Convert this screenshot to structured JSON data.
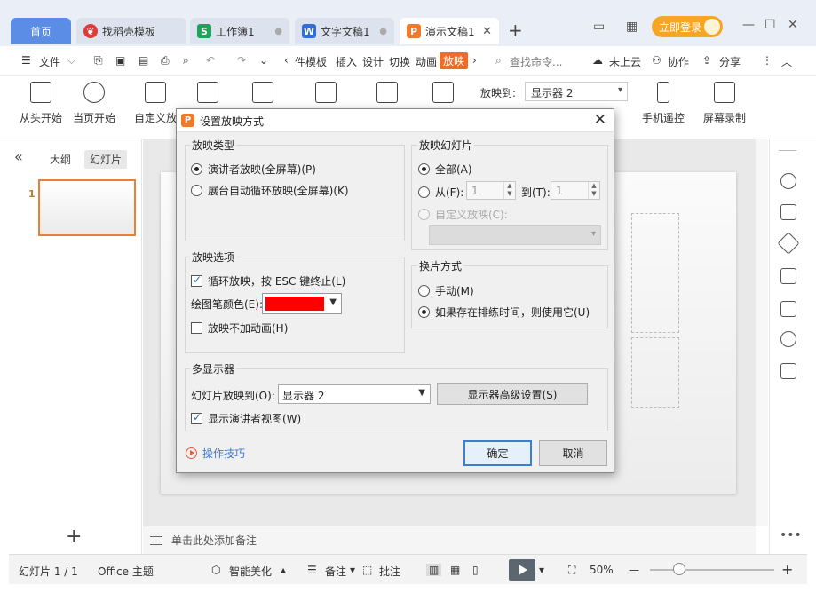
{
  "tabs": [
    {
      "label": "首页",
      "icon": "home-tab"
    },
    {
      "label": "找稻壳模板",
      "icon": "docer-icon"
    },
    {
      "label": "工作簿1",
      "icon": "spreadsheet-icon",
      "icon_glyph": "S"
    },
    {
      "label": "文字文稿1",
      "icon": "writer-icon",
      "icon_glyph": "W"
    },
    {
      "label": "演示文稿1",
      "icon": "presentation-icon",
      "icon_glyph": "P"
    }
  ],
  "new_tab": "+",
  "login": "立即登录",
  "menu": {
    "file": "文件",
    "items": [
      "件模板",
      "插入",
      "设计",
      "切换",
      "动画",
      "放映"
    ],
    "active": "放映",
    "search": "查找命令...",
    "cloud": "未上云",
    "collab": "协作",
    "share": "分享"
  },
  "ribbon": {
    "from_start": "从头开始",
    "from_current": "当页开始",
    "custom": "自定义放",
    "show_on_label": "放映到:",
    "show_on_value": "显示器 2",
    "phone_remote": "手机遥控",
    "screen_record": "屏幕录制"
  },
  "left_panel": {
    "outline": "大纲",
    "slides": "幻灯片",
    "slide_number": "1"
  },
  "notes_placeholder": "单击此处添加备注",
  "status": {
    "slide_count": "幻灯片 1 / 1",
    "theme": "Office 主题",
    "beautify": "智能美化",
    "notes": "备注",
    "comments": "批注",
    "zoom": "50%"
  },
  "dialog": {
    "title": "设置放映方式",
    "show_type": {
      "label": "放映类型",
      "options": [
        "演讲者放映(全屏幕)(P)",
        "展台自动循环放映(全屏幕)(K)"
      ],
      "selected": 0
    },
    "show_slides": {
      "label": "放映幻灯片",
      "all": "全部(A)",
      "from": "从(F):",
      "from_value": "1",
      "to": "到(T):",
      "to_value": "1",
      "custom": "自定义放映(C):"
    },
    "show_options": {
      "label": "放映选项",
      "loop": "循环放映，按 ESC 键终止(L)",
      "loop_checked": true,
      "pen_color_label": "绘图笔颜色(E):",
      "pen_color": "#ff0000",
      "no_animation": "放映不加动画(H)",
      "no_animation_checked": false
    },
    "advance": {
      "label": "换片方式",
      "manual": "手动(M)",
      "timings": "如果存在排练时间，则使用它(U)",
      "selected": 1
    },
    "multi_monitor": {
      "label": "多显示器",
      "show_on_label": "幻灯片放映到(O):",
      "show_on_value": "显示器 2",
      "advanced_button": "显示器高级设置(S)",
      "presenter_view": "显示演讲者视图(W)",
      "presenter_view_checked": true
    },
    "tips": "操作技巧",
    "ok": "确定",
    "cancel": "取消"
  }
}
